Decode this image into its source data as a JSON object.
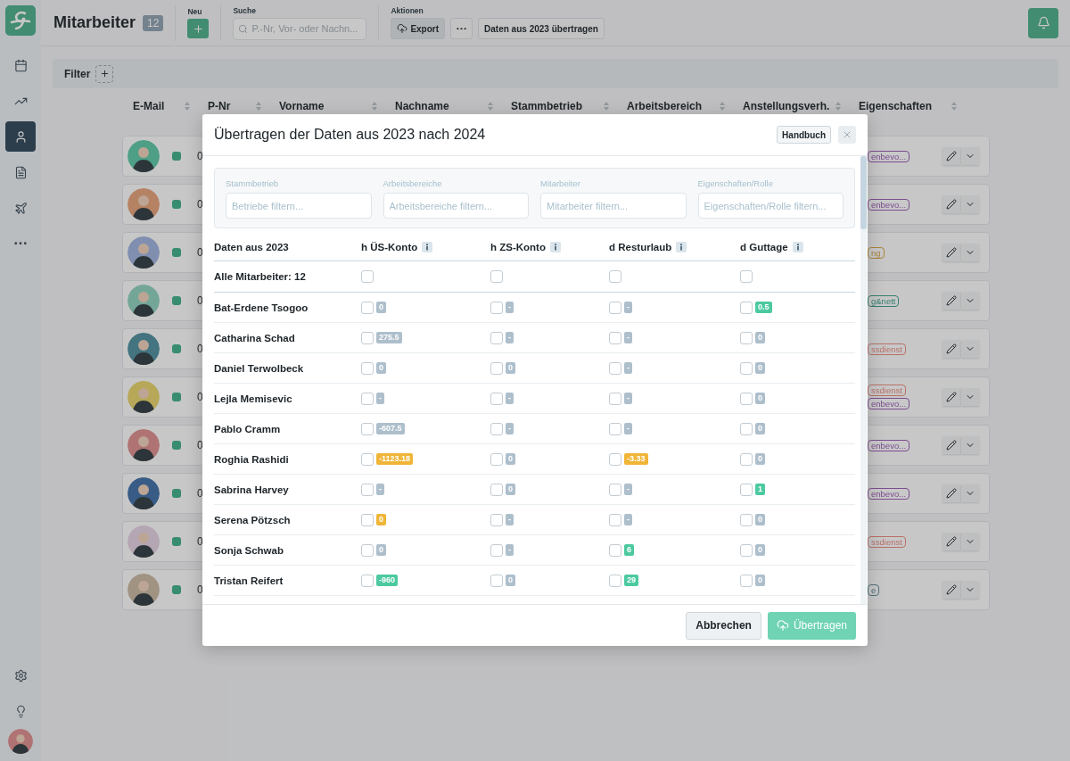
{
  "sidebar": {
    "items": [
      {
        "kind": "calendar",
        "selected": false
      },
      {
        "kind": "trend",
        "selected": false
      },
      {
        "kind": "user",
        "selected": true
      },
      {
        "kind": "document",
        "selected": false
      },
      {
        "kind": "plane",
        "selected": false
      },
      {
        "kind": "more",
        "selected": false
      }
    ],
    "bottom_items": [
      {
        "kind": "settings",
        "selected": false
      },
      {
        "kind": "idea",
        "selected": false
      }
    ]
  },
  "header": {
    "title": "Mitarbeiter",
    "count": "12",
    "new_label": "Neu",
    "search_label": "Suche",
    "search_placeholder": "P.-Nr, Vor- oder Nachn...",
    "actions_label": "Aktionen",
    "export_button": "Export",
    "transfer_button": "Daten aus 2023 übertragen"
  },
  "filter_bar": {
    "label": "Filter"
  },
  "table": {
    "columns": [
      "E-Mail",
      "P-Nr",
      "Vorname",
      "Nachname",
      "Stammbetrieb",
      "Arbeitsbereich",
      "Anstellungsverh.",
      "Eigenschaften"
    ],
    "rows": [
      {
        "p_nr": "0",
        "tags": [
          {
            "label": "enbevo...",
            "color": "#7d4c90"
          }
        ]
      },
      {
        "p_nr": "0",
        "tags": [
          {
            "label": "enbevo...",
            "color": "#7d4c90"
          }
        ]
      },
      {
        "p_nr": "0",
        "tags": [
          {
            "label": "ng",
            "color": "#aa843b"
          }
        ]
      },
      {
        "p_nr": "0",
        "tags": [
          {
            "label": "g&nett",
            "color": "#367f6e"
          }
        ]
      },
      {
        "p_nr": "0",
        "tags": [
          {
            "label": "ssdienst",
            "color": "#b86f66"
          }
        ]
      },
      {
        "p_nr": "0",
        "tags": [
          {
            "label": "ssdienst",
            "color": "#b86f66"
          },
          {
            "label": "enbevo...",
            "color": "#7d4c90"
          }
        ]
      },
      {
        "p_nr": "0",
        "tags": [
          {
            "label": "enbevo...",
            "color": "#7d4c90"
          }
        ]
      },
      {
        "p_nr": "0",
        "tags": [
          {
            "label": "enbevo...",
            "color": "#7d4c90"
          }
        ]
      },
      {
        "p_nr": "0",
        "tags": [
          {
            "label": "ssdienst",
            "color": "#b86f66"
          }
        ]
      },
      {
        "p_nr": "0",
        "tags": [
          {
            "label": "e",
            "color": "#4e7179"
          }
        ]
      }
    ]
  },
  "dialog": {
    "title": "Übertragen der Daten aus 2023 nach 2024",
    "manual_button": "Handbuch",
    "filters": [
      {
        "label": "Stammbetrieb",
        "placeholder": "Betriebe filtern..."
      },
      {
        "label": "Arbeitsbereiche",
        "placeholder": "Arbeitsbereiche filtern..."
      },
      {
        "label": "Mitarbeiter",
        "placeholder": "Mitarbeiter filtern..."
      },
      {
        "label": "Eigenschaften/Rolle",
        "placeholder": "Eigenschaften/Rolle filtern..."
      }
    ],
    "name_column": "Daten aus 2023",
    "columns": [
      "h ÜS-Konto",
      "h ZS-Konto",
      "d Resturlaub",
      "d Guttage"
    ],
    "all_row": {
      "label": "Alle Mitarbeiter: 12",
      "checks": [
        false,
        false,
        false,
        false
      ]
    },
    "rows": [
      {
        "name": "Bat-Erdene Tsogoo",
        "cells": [
          {
            "value": "0",
            "color": "#aebfcc",
            "checked": false
          },
          {
            "value": "-",
            "color": "#aebfcc",
            "checked": false
          },
          {
            "value": "-",
            "color": "#aebfcc",
            "checked": false
          },
          {
            "value": "0.5",
            "color": "#4cc9a0",
            "checked": false
          }
        ]
      },
      {
        "name": "Catharina Schad",
        "cells": [
          {
            "value": "275.5",
            "color": "#aebfcc",
            "checked": false
          },
          {
            "value": "-",
            "color": "#aebfcc",
            "checked": false
          },
          {
            "value": "-",
            "color": "#aebfcc",
            "checked": false
          },
          {
            "value": "0",
            "color": "#aebfcc",
            "checked": false
          }
        ]
      },
      {
        "name": "Daniel Terwolbeck",
        "cells": [
          {
            "value": "0",
            "color": "#aebfcc",
            "checked": false
          },
          {
            "value": "0",
            "color": "#aebfcc",
            "checked": false
          },
          {
            "value": "-",
            "color": "#aebfcc",
            "checked": false
          },
          {
            "value": "0",
            "color": "#aebfcc",
            "checked": false
          }
        ]
      },
      {
        "name": "Lejla Memisevic",
        "cells": [
          {
            "value": "-",
            "color": "#aebfcc",
            "checked": false
          },
          {
            "value": "-",
            "color": "#aebfcc",
            "checked": false
          },
          {
            "value": "-",
            "color": "#aebfcc",
            "checked": false
          },
          {
            "value": "0",
            "color": "#aebfcc",
            "checked": false
          }
        ]
      },
      {
        "name": "Pablo Cramm",
        "cells": [
          {
            "value": "-607.5",
            "color": "#aebfcc",
            "checked": false
          },
          {
            "value": "-",
            "color": "#aebfcc",
            "checked": false
          },
          {
            "value": "-",
            "color": "#aebfcc",
            "checked": false
          },
          {
            "value": "0",
            "color": "#aebfcc",
            "checked": false
          }
        ]
      },
      {
        "name": "Roghia Rashidi",
        "cells": [
          {
            "value": "-1123.18",
            "color": "#f0b537",
            "checked": false
          },
          {
            "value": "0",
            "color": "#aebfcc",
            "checked": false
          },
          {
            "value": "-3.33",
            "color": "#f0b537",
            "checked": false
          },
          {
            "value": "0",
            "color": "#aebfcc",
            "checked": false
          }
        ]
      },
      {
        "name": "Sabrina Harvey",
        "cells": [
          {
            "value": "-",
            "color": "#aebfcc",
            "checked": false
          },
          {
            "value": "0",
            "color": "#aebfcc",
            "checked": false
          },
          {
            "value": "-",
            "color": "#aebfcc",
            "checked": false
          },
          {
            "value": "1",
            "color": "#4cc9a0",
            "checked": false
          }
        ]
      },
      {
        "name": "Serena Pötzsch",
        "cells": [
          {
            "value": "0",
            "color": "#f0b537",
            "checked": false
          },
          {
            "value": "-",
            "color": "#aebfcc",
            "checked": false
          },
          {
            "value": "-",
            "color": "#aebfcc",
            "checked": false
          },
          {
            "value": "0",
            "color": "#aebfcc",
            "checked": false
          }
        ]
      },
      {
        "name": "Sonja Schwab",
        "cells": [
          {
            "value": "0",
            "color": "#aebfcc",
            "checked": false
          },
          {
            "value": "-",
            "color": "#aebfcc",
            "checked": false
          },
          {
            "value": "6",
            "color": "#4cc9a0",
            "checked": false
          },
          {
            "value": "0",
            "color": "#aebfcc",
            "checked": false
          }
        ]
      },
      {
        "name": "Tristan Reifert",
        "cells": [
          {
            "value": "-960",
            "color": "#4cc9a0",
            "checked": false
          },
          {
            "value": "0",
            "color": "#aebfcc",
            "checked": false
          },
          {
            "value": "29",
            "color": "#4cc9a0",
            "checked": false
          },
          {
            "value": "0",
            "color": "#aebfcc",
            "checked": false
          }
        ]
      }
    ],
    "cancel_button": "Abbrechen",
    "submit_button": {
      "label": "Übertragen",
      "disabled": true
    }
  }
}
